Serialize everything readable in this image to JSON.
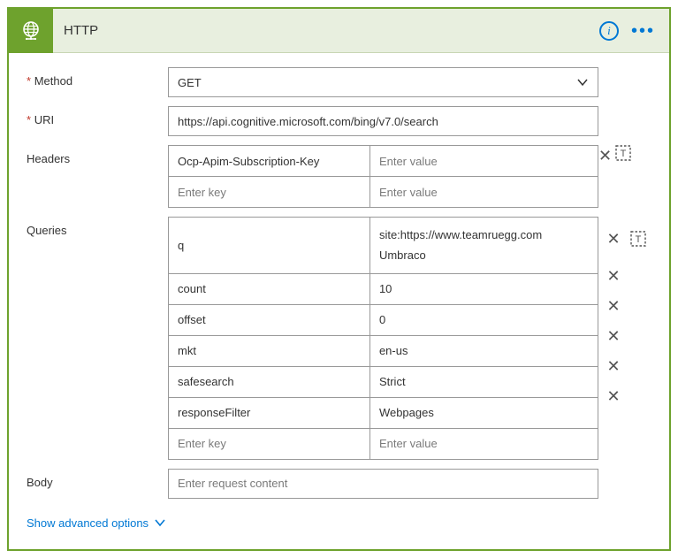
{
  "header": {
    "title": "HTTP",
    "icon": "globe-icon"
  },
  "method": {
    "label": "Method",
    "required": "*",
    "value": "GET"
  },
  "uri": {
    "label": "URI",
    "required": "*",
    "value": "https://api.cognitive.microsoft.com/bing/v7.0/search"
  },
  "headers": {
    "label": "Headers",
    "row0_key": "Ocp-Apim-Subscription-Key",
    "row0_val_placeholder": "Enter value",
    "placeholder_key": "Enter key",
    "placeholder_val": "Enter value"
  },
  "queries": {
    "label": "Queries",
    "rows": {
      "0": {
        "key": "q",
        "val": "site:https://www.teamruegg.com Umbraco"
      },
      "1": {
        "key": "count",
        "val": "10"
      },
      "2": {
        "key": "offset",
        "val": "0"
      },
      "3": {
        "key": "mkt",
        "val": "en-us"
      },
      "4": {
        "key": "safesearch",
        "val": "Strict"
      },
      "5": {
        "key": "responseFilter",
        "val": "Webpages"
      }
    },
    "placeholder_key": "Enter key",
    "placeholder_val": "Enter value"
  },
  "body": {
    "label": "Body",
    "placeholder": "Enter request content"
  },
  "advanced": {
    "label": "Show advanced options"
  }
}
